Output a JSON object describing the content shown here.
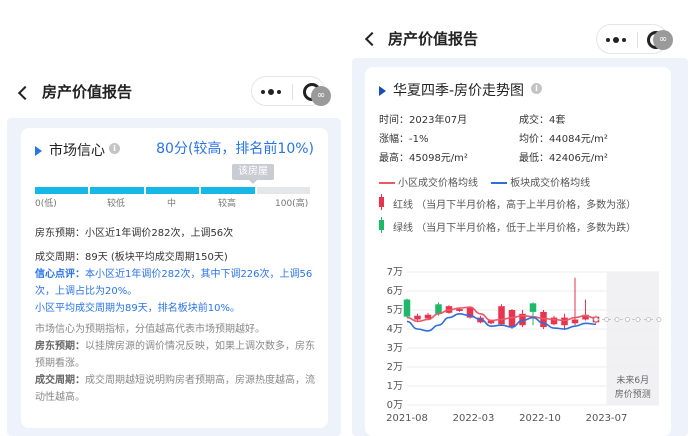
{
  "left": {
    "header_title": "房产价值报告",
    "market": {
      "title": "市场信心",
      "score_text": "80分(较高，排名前10%)",
      "current_tag": "该房屋",
      "scale_labels": [
        "0(低)",
        "较低",
        "中",
        "较高",
        "100(高)"
      ],
      "level_fraction": 0.8,
      "bar_color": "#16b8e8",
      "bar_empty_color": "#e4e6ea",
      "row1": "房东预期：小区近1年调价282次，上调56次",
      "row2": "成交周期：89天 (板块平均成交周期150天)",
      "comment_label": "信心点评：",
      "comment": "本小区近1年调价282次，其中下调226次，上调56次，上调占比为20%。",
      "comment2": "小区平均成交周期为89天，排名板块前10%。",
      "note1": "市场信心为预期指标，分值越高代表市场预期越好。",
      "note2_label": "房东预期：",
      "note2": "以挂牌房源的调价情况反映，如果上调次数多，房东预期看涨。",
      "note3_label": "成交周期：",
      "note3": "成交周期越短说明购房者预期高，房源热度越高，流动性越高。"
    }
  },
  "right": {
    "header_title": "房产价值报告",
    "trend": {
      "title": "华夏四季-房价走势图",
      "time": "时间：2023年07月",
      "deals": "成交：4套",
      "change": "涨幅：-1%",
      "avg": "均价：44084元/m²",
      "high": "最高：45098元/m²",
      "low": "最低：42406元/m²",
      "legend_community": "小区成交价格均线",
      "legend_block": "板块成交价格均线",
      "legend_red": "红线 （当月下半月价格，高于上半月价格，多数为涨）",
      "legend_green": "绿线 （当月下半月价格，低于上半月价格，多数为跌）",
      "forecast_line1": "未来6月",
      "forecast_line2": "房价预测",
      "red_color": "#e8344e",
      "green_color": "#1fb86a",
      "community_color": "#e85a6a",
      "block_color": "#2f6fd8"
    }
  },
  "chart_data": {
    "type": "line",
    "title": "华夏四季-房价走势图",
    "xlabel": "",
    "ylabel": "",
    "x_ticks": [
      "2021-08",
      "2022-03",
      "2022-10",
      "2023-07"
    ],
    "y_ticks": [
      "0万",
      "1万",
      "2万",
      "3万",
      "4万",
      "5万",
      "6万",
      "7万"
    ],
    "ylim": [
      0,
      7
    ],
    "grid": true,
    "x_range": [
      0,
      24
    ],
    "candles": [
      {
        "x": 0,
        "open": 4.65,
        "close": 5.55,
        "high": 5.6,
        "low": 4.6,
        "up": false
      },
      {
        "x": 1,
        "open": 4.7,
        "close": 4.5,
        "high": 4.8,
        "low": 4.4,
        "up": true
      },
      {
        "x": 2,
        "open": 4.75,
        "close": 4.55,
        "high": 4.85,
        "low": 4.5,
        "up": true
      },
      {
        "x": 3,
        "open": 4.8,
        "close": 5.3,
        "high": 5.4,
        "low": 4.7,
        "up": false
      },
      {
        "x": 4,
        "open": 5.2,
        "close": 4.85,
        "high": 5.25,
        "low": 4.8,
        "up": true
      },
      {
        "x": 5,
        "open": 4.95,
        "close": 5.05,
        "high": 5.1,
        "low": 4.9,
        "up": true
      },
      {
        "x": 6,
        "open": 5.15,
        "close": 4.6,
        "high": 5.2,
        "low": 4.55,
        "up": true
      },
      {
        "x": 7,
        "open": 4.6,
        "close": 4.35,
        "high": 4.7,
        "low": 4.3,
        "up": true
      },
      {
        "x": 8,
        "open": 4.3,
        "close": 4.45,
        "high": 4.5,
        "low": 4.25,
        "up": true
      },
      {
        "x": 9,
        "open": 4.25,
        "close": 5.2,
        "high": 5.3,
        "low": 4.2,
        "up": true
      },
      {
        "x": 10,
        "open": 5.0,
        "close": 4.1,
        "high": 5.05,
        "low": 4.0,
        "up": true
      },
      {
        "x": 11,
        "open": 4.2,
        "close": 4.8,
        "high": 5.0,
        "low": 4.1,
        "up": true
      },
      {
        "x": 12,
        "open": 5.35,
        "close": 4.9,
        "high": 5.4,
        "low": 4.2,
        "up": false
      },
      {
        "x": 13,
        "open": 4.1,
        "close": 4.9,
        "high": 5.0,
        "low": 4.0,
        "up": true
      },
      {
        "x": 14,
        "open": 4.25,
        "close": 4.6,
        "high": 4.7,
        "low": 4.2,
        "up": true
      },
      {
        "x": 15,
        "open": 4.2,
        "close": 4.6,
        "high": 4.8,
        "low": 3.95,
        "up": true
      },
      {
        "x": 16,
        "open": 4.3,
        "close": 4.5,
        "high": 6.7,
        "low": 4.2,
        "up": true
      },
      {
        "x": 17,
        "open": 4.5,
        "close": 4.75,
        "high": 5.55,
        "low": 4.45,
        "up": true
      },
      {
        "x": 18,
        "open": 4.35,
        "close": 4.65,
        "high": 4.7,
        "low": 4.3,
        "up": true
      }
    ],
    "series": [
      {
        "name": "小区成交价格均线",
        "x": [
          0,
          1,
          2,
          3,
          4,
          5,
          6,
          7,
          8,
          9,
          10,
          11,
          12,
          13,
          14,
          15,
          16,
          17,
          18
        ],
        "values": [
          4.6,
          4.4,
          4.5,
          4.8,
          5.0,
          5.1,
          5.15,
          4.8,
          4.45,
          4.5,
          4.6,
          4.7,
          4.65,
          4.55,
          4.5,
          4.45,
          4.6,
          4.7,
          4.55
        ]
      },
      {
        "name": "板块成交价格均线",
        "x": [
          0,
          1,
          2,
          3,
          4,
          5,
          6,
          7,
          8,
          9,
          10,
          11,
          12,
          13,
          14,
          15,
          16,
          17,
          18
        ],
        "values": [
          4.4,
          4.0,
          3.9,
          4.2,
          4.6,
          4.8,
          4.7,
          4.5,
          4.15,
          4.2,
          4.1,
          4.45,
          4.6,
          4.3,
          4.05,
          4.0,
          4.15,
          4.3,
          4.25
        ]
      },
      {
        "name": "",
        "x": [
          18,
          19,
          20,
          21,
          22,
          23,
          24
        ],
        "values": [
          4.5,
          4.5,
          4.5,
          4.5,
          4.5,
          4.5,
          4.5
        ]
      }
    ],
    "forecast_start_x": 19
  }
}
